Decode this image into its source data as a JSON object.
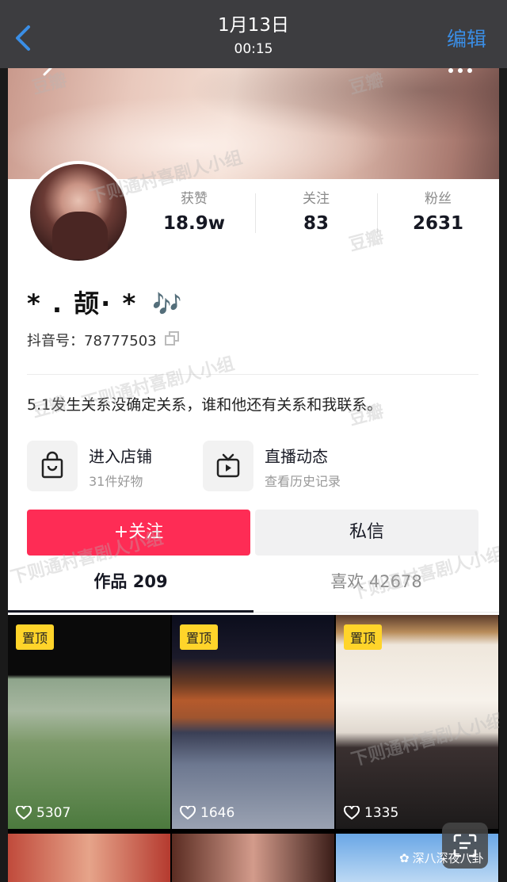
{
  "topbar": {
    "date": "1月13日",
    "time": "00:15",
    "edit_label": "编辑"
  },
  "profile": {
    "stats": [
      {
        "label": "获赞",
        "value": "18.9w"
      },
      {
        "label": "关注",
        "value": "83"
      },
      {
        "label": "粉丝",
        "value": "2631"
      }
    ],
    "nickname": "* . 颉· *",
    "nickname_emoji": "🎶",
    "douyin_id": "抖音号：78777503",
    "bio": "5.1发生关系没确定关系，谁和他还有关系和我联系。"
  },
  "services": [
    {
      "title": "进入店铺",
      "subtitle": "31件好物",
      "icon": "shopping-bag-icon"
    },
    {
      "title": "直播动态",
      "subtitle": "查看历史记录",
      "icon": "live-tv-icon"
    }
  ],
  "actions": {
    "follow_label": "+关注",
    "message_label": "私信"
  },
  "tabs": [
    {
      "label": "作品 209",
      "active": true
    },
    {
      "label": "喜欢 42678",
      "active": false
    }
  ],
  "videos": [
    {
      "pinned_label": "置顶",
      "likes": "5307"
    },
    {
      "pinned_label": "置顶",
      "likes": "1646"
    },
    {
      "pinned_label": "置顶",
      "likes": "1335"
    }
  ],
  "watermarks": {
    "brand": "豆瓣",
    "group": "下则通村喜剧人小组"
  },
  "credit": {
    "text": "深八深夜八卦"
  },
  "colors": {
    "follow": "#fe2c55",
    "pin": "#ffd42a",
    "edit": "#3a8ee6",
    "note": "#3aa6e8"
  }
}
